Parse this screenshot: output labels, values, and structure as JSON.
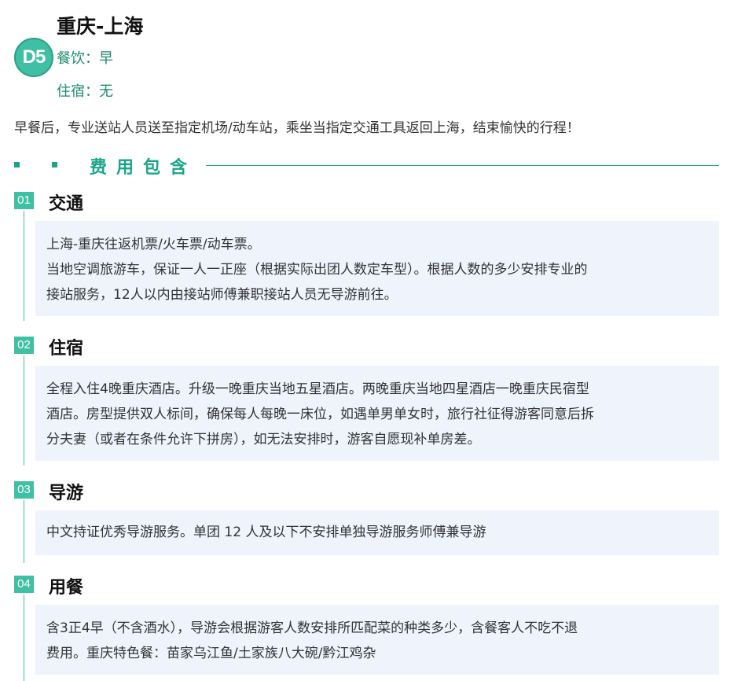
{
  "day": {
    "badge": "D5",
    "title": "重庆-上海",
    "meal": "餐饮：早",
    "stay": "住宿：无",
    "description": "早餐后，专业送站人员送至指定机场/动车站，乘坐当指定交通工具返回上海，结束愉快的行程！"
  },
  "fees": {
    "title": "费用包含",
    "sections": [
      {
        "num": "01",
        "title": "交通",
        "lines": [
          "上海-重庆往返机票/火车票/动车票。",
          "当地空调旅游车，保证一人一正座（根据实际出团人数定车型）。根据人数的多少安排专业的",
          "接站服务，12人以内由接站师傅兼职接站人员无导游前往。"
        ]
      },
      {
        "num": "02",
        "title": "住宿",
        "lines": [
          "全程入住4晚重庆酒店。升级一晚重庆当地五星酒店。两晚重庆当地四星酒店一晚重庆民宿型",
          "酒店。房型提供双人标间，确保每人每晚一床位，如遇单男单女时，旅行社征得游客同意后拆",
          "分夫妻（或者在条件允许下拼房），如无法安排时，游客自愿现补单房差。"
        ]
      },
      {
        "num": "03",
        "title": "导游",
        "lines": [
          "中文持证优秀导游服务。单团 12 人及以下不安排单独导游服务师傅兼导游"
        ]
      },
      {
        "num": "04",
        "title": "用餐",
        "lines": [
          "含3正4早（不含酒水），导游会根据游客人数安排所匹配菜的种类多少，含餐客人不吃不退",
          "费用。重庆特色餐：苗家乌江鱼/土家族八大碗/黔江鸡杂"
        ]
      }
    ]
  }
}
